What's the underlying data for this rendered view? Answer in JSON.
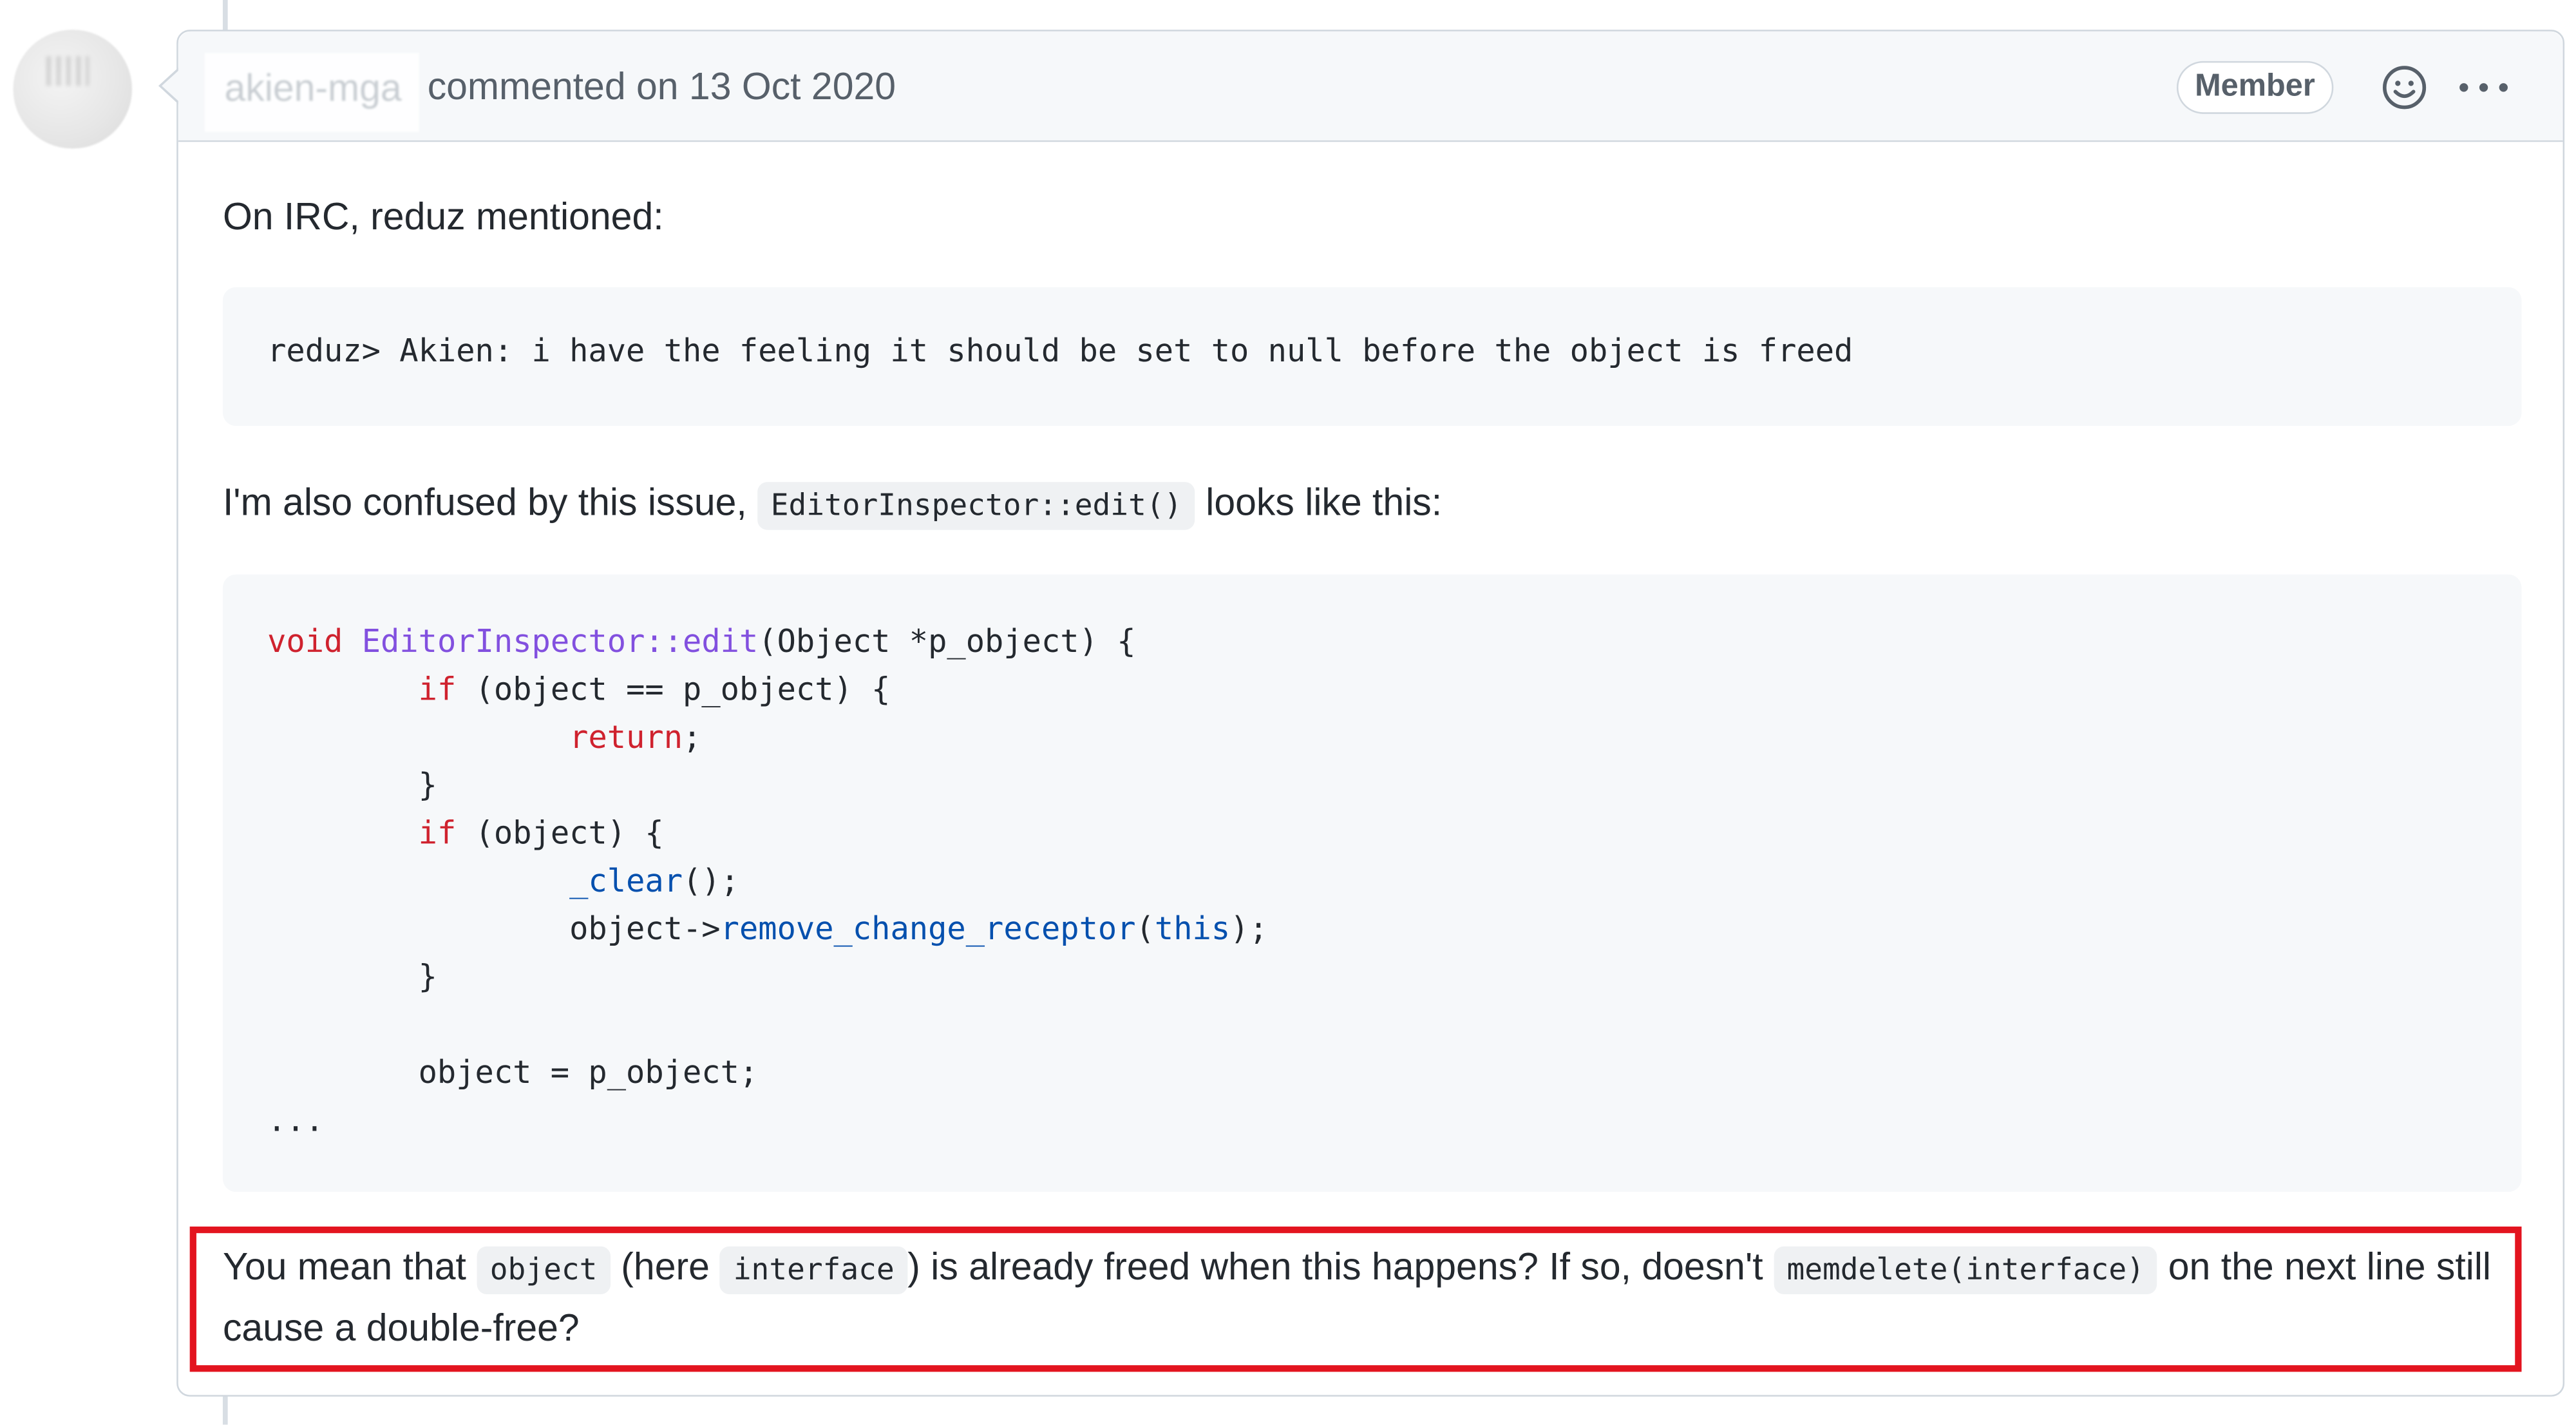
{
  "comment": {
    "author": "akien-mga",
    "header_action": "commented on 13 Oct 2020",
    "badge": "Member",
    "icons": [
      "smiley-icon",
      "kebab-horizontal-icon"
    ],
    "para1": "On IRC, reduz mentioned:",
    "quote_code": "reduz> Akien: i have the feeling it should be set to null before the object is freed",
    "para2_pre": "I'm also confused by this issue,",
    "para2_code": "EditorInspector::edit()",
    "para2_post": "looks like this:",
    "code_lines": {
      "l1_kw": "void",
      "l1_fn": "EditorInspector::edit",
      "l1_rest": "(Object *p_object) {",
      "l2_indent": "        ",
      "l2_kw": "if",
      "l2_rest": " (object == p_object) {",
      "l3_indent": "                ",
      "l3_kw": "return",
      "l3_rest": ";",
      "l4": "        }",
      "l5_indent": "        ",
      "l5_kw": "if",
      "l5_rest": " (object) {",
      "l6_indent": "                ",
      "l6_call": "_clear",
      "l6_rest": "();",
      "l7_pre": "                object->",
      "l7_call": "remove_change_receptor",
      "l7_mid": "(",
      "l7_this": "this",
      "l7_rest": ");",
      "l8": "        }",
      "l9": "",
      "l10": "        object = p_object;",
      "l11": "..."
    },
    "para3": {
      "t1": "You mean that",
      "c1": "object",
      "t2": "(here",
      "c2": "interface",
      "t3": ") is already freed when this happens? If so, doesn't",
      "c3": "memdelete(interface)",
      "t4": "on the next line still cause a double-free?"
    }
  }
}
